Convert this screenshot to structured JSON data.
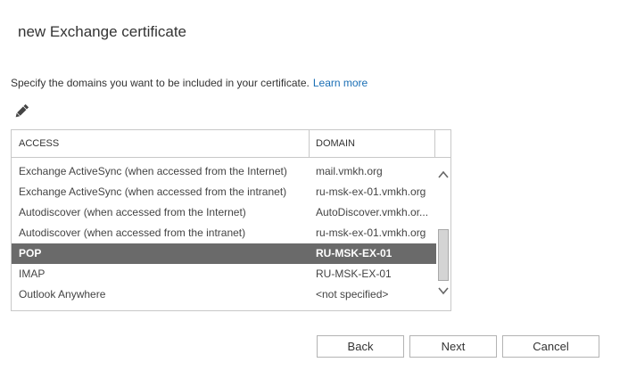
{
  "dialog": {
    "title": "new Exchange certificate",
    "instructions": "Specify the domains you want to be included in your certificate.",
    "learn_more": "Learn more"
  },
  "toolbar": {
    "edit_icon": "pencil-icon"
  },
  "grid": {
    "columns": [
      "ACCESS",
      "DOMAIN"
    ],
    "rows": [
      {
        "access": "Exchange ActiveSync (when accessed from the Internet)",
        "domain": "mail.vmkh.org"
      },
      {
        "access": "Exchange ActiveSync (when accessed from the intranet)",
        "domain": "ru-msk-ex-01.vmkh.org"
      },
      {
        "access": "Autodiscover (when accessed from the Internet)",
        "domain": "AutoDiscover.vmkh.or..."
      },
      {
        "access": "Autodiscover (when accessed from the intranet)",
        "domain": "ru-msk-ex-01.vmkh.org"
      },
      {
        "access": "POP",
        "domain": "RU-MSK-EX-01"
      },
      {
        "access": "IMAP",
        "domain": "RU-MSK-EX-01"
      },
      {
        "access": "Outlook Anywhere",
        "domain": "<not specified>"
      }
    ],
    "selected_index": 4
  },
  "buttons": {
    "back": "Back",
    "next": "Next",
    "cancel": "Cancel"
  },
  "colors": {
    "link": "#1a6fb5",
    "selected_row": "#6a6a6a"
  }
}
